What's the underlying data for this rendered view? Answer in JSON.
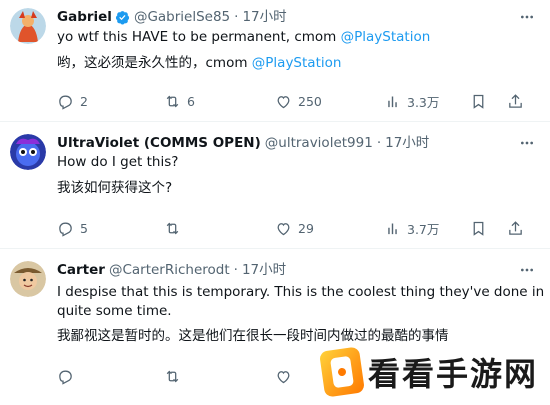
{
  "tweets": [
    {
      "name": "Gabriel",
      "verified": true,
      "handle": "@GabrielSe85",
      "dot": "·",
      "time": "17小时",
      "text_line1_prefix": "yo wtf this HAVE to be permanent, cmom ",
      "text_line1_mention": "@PlayStation",
      "text_line2_prefix": "哟，这必须是永久性的，cmom ",
      "text_line2_mention": "@PlayStation",
      "replies": "2",
      "retweets": "6",
      "likes": "250",
      "views": "3.3万"
    },
    {
      "name": "UltraViolet (COMMS OPEN)",
      "handle": "@ultraviolet991",
      "dot": "·",
      "time": "17小时",
      "text_line1": "How do I get this?",
      "text_line2": "我该如何获得这个?",
      "replies": "5",
      "retweets": "",
      "likes": "29",
      "views": "3.7万"
    },
    {
      "name": "Carter",
      "handle": "@CarterRicherodt",
      "dot": "·",
      "time": "17小时",
      "text_line1": "I despise that this is temporary. This is the coolest thing they've done in",
      "text_line2": "quite some time.",
      "text_line3": "我鄙视这是暂时的。这是他们在很长一段时间内做过的最酷的事情",
      "replies": "",
      "retweets": "",
      "likes": "",
      "views": ""
    }
  ],
  "watermark": {
    "text": "看看手游网"
  },
  "colors": {
    "accent": "#1d9bf0",
    "muted": "#536471",
    "text": "#0f1419"
  },
  "icons": [
    "verified-badge-icon",
    "more-icon",
    "reply-icon",
    "retweet-icon",
    "like-icon",
    "views-icon",
    "bookmark-icon",
    "share-icon"
  ]
}
